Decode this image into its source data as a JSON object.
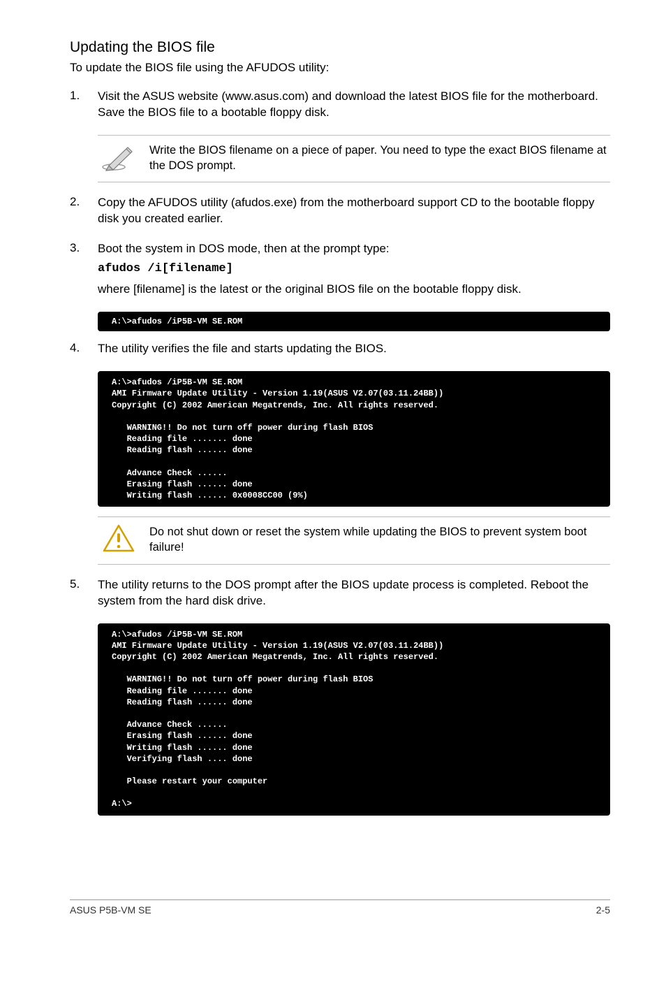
{
  "heading": "Updating the BIOS file",
  "intro": "To update the BIOS file using the AFUDOS utility:",
  "step1_num": "1.",
  "step1_text": "Visit the ASUS website (www.asus.com) and download the latest BIOS file for the motherboard. Save the BIOS file to a bootable floppy disk.",
  "note1_text": "Write the BIOS filename on a piece of paper. You need to type the exact BIOS filename at the DOS prompt.",
  "step2_num": "2.",
  "step2_text": "Copy the AFUDOS utility (afudos.exe) from the motherboard support CD to the bootable floppy disk you created earlier.",
  "step3_num": "3.",
  "step3_text": "Boot the system in DOS mode, then at the prompt type:",
  "step3_cmd": "afudos /i[filename]",
  "step3_where": "where [filename] is the latest or the original BIOS file on the bootable floppy disk.",
  "terminal1": "A:\\>afudos /iP5B-VM SE.ROM",
  "step4_num": "4.",
  "step4_text": "The utility verifies the file and starts updating the BIOS.",
  "terminal2": "A:\\>afudos /iP5B-VM SE.ROM\nAMI Firmware Update Utility - Version 1.19(ASUS V2.07(03.11.24BB))\nCopyright (C) 2002 American Megatrends, Inc. All rights reserved.\n\n   WARNING!! Do not turn off power during flash BIOS\n   Reading file ....... done\n   Reading flash ...... done\n\n   Advance Check ......\n   Erasing flash ...... done\n   Writing flash ...... 0x0008CC00 (9%)",
  "warning_text": "Do not shut down or reset the system while updating the BIOS to prevent system boot failure!",
  "step5_num": "5.",
  "step5_text": "The utility returns to the DOS prompt after the BIOS update process is completed. Reboot the system from the hard disk drive.",
  "terminal3": "A:\\>afudos /iP5B-VM SE.ROM\nAMI Firmware Update Utility - Version 1.19(ASUS V2.07(03.11.24BB))\nCopyright (C) 2002 American Megatrends, Inc. All rights reserved.\n\n   WARNING!! Do not turn off power during flash BIOS\n   Reading file ....... done\n   Reading flash ...... done\n\n   Advance Check ......\n   Erasing flash ...... done\n   Writing flash ...... done\n   Verifying flash .... done\n\n   Please restart your computer\n\nA:\\>",
  "footer_left": "ASUS P5B-VM SE",
  "footer_right": "2-5"
}
